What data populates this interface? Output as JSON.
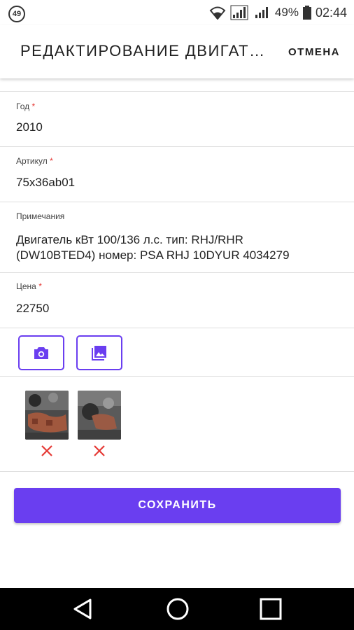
{
  "status_bar": {
    "notification_count": "49",
    "battery_percent": "49%",
    "time": "02:44",
    "icons": [
      "wifi-icon",
      "signal-icon-sim1",
      "signal-icon-sim2",
      "battery-icon"
    ]
  },
  "app_bar": {
    "title": "РЕДАКТИРОВАНИЕ ДВИГАТ…",
    "cancel_label": "ОТМЕНА"
  },
  "form": {
    "year": {
      "label": "Год",
      "required_mark": "*",
      "value": "2010"
    },
    "article": {
      "label": "Артикул",
      "required_mark": "*",
      "value": "75x36ab01"
    },
    "notes": {
      "label": "Примечания",
      "value": "Двигатель кВт 100/136 л.с. тип: RHJ/RHR (DW10BTED4) номер: PSA RHJ 10DYUR 4034279"
    },
    "price": {
      "label": "Цена",
      "required_mark": "*",
      "value": "22750"
    }
  },
  "media": {
    "camera_icon": "camera-icon",
    "gallery_icon": "gallery-icon",
    "photos": [
      "engine-photo-1",
      "engine-photo-2"
    ],
    "remove_icon": "close-icon"
  },
  "save_label": "СОХРАНИТЬ",
  "colors": {
    "accent": "#6a3ef0",
    "required": "#e53935",
    "remove": "#e53935"
  },
  "nav_bar": {
    "icons": [
      "back-icon",
      "home-icon",
      "recents-icon"
    ]
  }
}
